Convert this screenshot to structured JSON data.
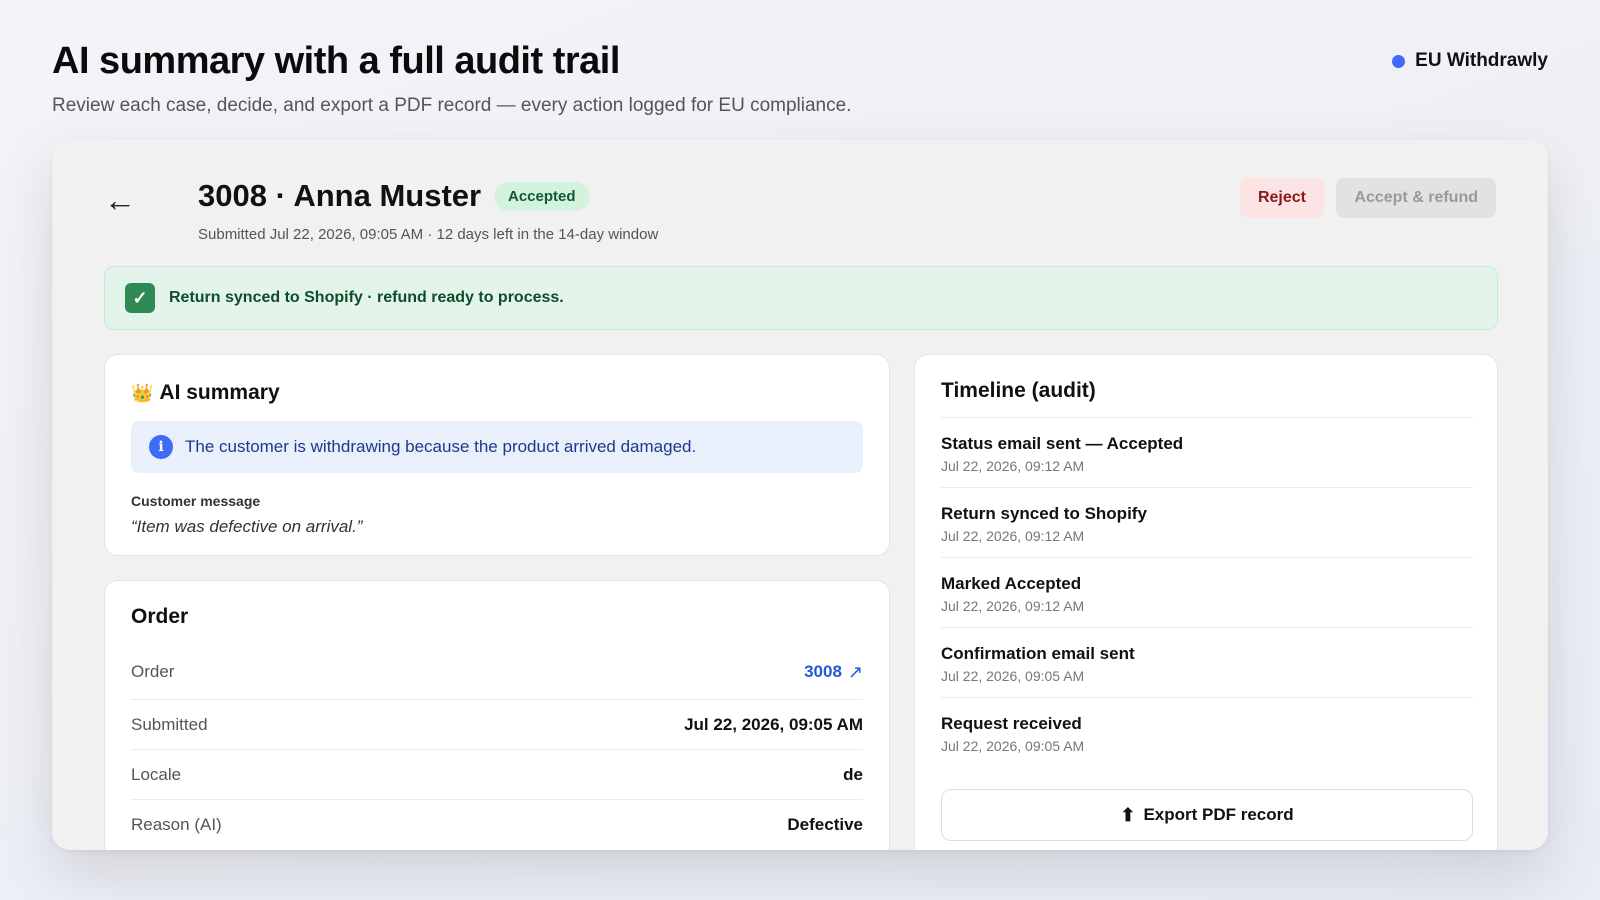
{
  "hero": {
    "title": "AI summary with a full audit trail",
    "subtitle": "Review each case, decide, and export a PDF record — every action logged for EU compliance."
  },
  "brand": {
    "name": "EU Withdrawly",
    "dot_color": "#3f6cf6"
  },
  "case": {
    "back_icon": "←",
    "title": "3008 · Anna Muster",
    "status": "Accepted",
    "meta": "Submitted Jul 22, 2026, 09:05 AM · 12 days left in the 14-day window",
    "actions": {
      "reject": "Reject",
      "accept": "Accept & refund"
    }
  },
  "banner": {
    "icon": "check-icon",
    "check_glyph": "✓",
    "text": "Return synced to Shopify · refund ready to process."
  },
  "ai_summary": {
    "icon": "crown-icon",
    "crown_glyph": "👑",
    "title": "AI summary",
    "info_glyph": "i",
    "text": "The customer is withdrawing because the product arrived damaged.",
    "message_label": "Customer message",
    "message": "“Item was defective on arrival.”"
  },
  "order": {
    "title": "Order",
    "rows": [
      {
        "label": "Order",
        "value": "3008",
        "link_icon": "↗"
      },
      {
        "label": "Submitted",
        "value": "Jul 22, 2026, 09:05 AM"
      },
      {
        "label": "Locale",
        "value": "de"
      },
      {
        "label": "Reason (AI)",
        "value": "Defective"
      }
    ]
  },
  "timeline": {
    "title": "Timeline (audit)",
    "items": [
      {
        "event": "Status email sent — Accepted",
        "time": "Jul 22, 2026, 09:12 AM"
      },
      {
        "event": "Return synced to Shopify",
        "time": "Jul 22, 2026, 09:12 AM"
      },
      {
        "event": "Marked Accepted",
        "time": "Jul 22, 2026, 09:12 AM"
      },
      {
        "event": "Confirmation email sent",
        "time": "Jul 22, 2026, 09:05 AM"
      },
      {
        "event": "Request received",
        "time": "Jul 22, 2026, 09:05 AM"
      }
    ],
    "export_icon": "⬆",
    "export_label": "Export PDF record"
  }
}
